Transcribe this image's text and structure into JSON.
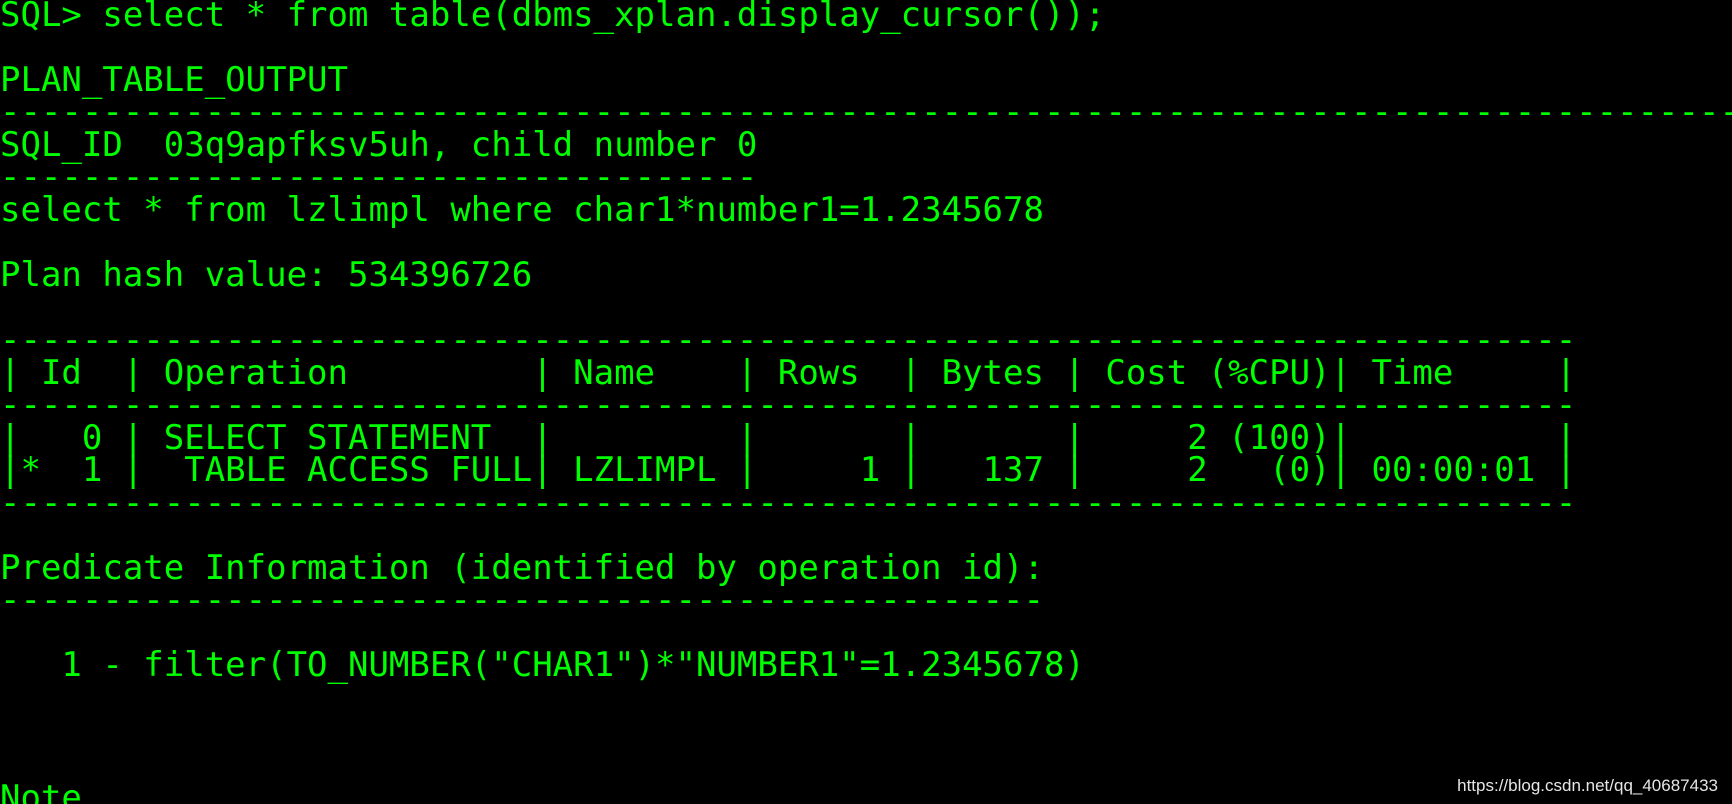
{
  "terminal": {
    "theme": {
      "background": "#000000",
      "foreground": "#00ff00"
    },
    "lines": [
      "SQL> select * from table(dbms_xplan.display_cursor());",
      "PLAN_TABLE_OUTPUT",
      "------------------------------------------------------------------------------------------",
      "SQL_ID  03q9apfksv5uh, child number 0",
      "-------------------------------------",
      "select * from lzlimpl where char1*number1=1.2345678",
      "Plan hash value: 534396726",
      "-----------------------------------------------------------------------------",
      "| Id  | Operation         | Name    | Rows  | Bytes | Cost (%CPU)| Time     |",
      "-----------------------------------------------------------------------------",
      "|   0 | SELECT STATEMENT  |         |       |       |     2 (100)|          |",
      "|*  1 |  TABLE ACCESS FULL| LZLIMPL |     1 |   137 |     2   (0)| 00:00:01 |",
      "-----------------------------------------------------------------------------",
      "Predicate Information (identified by operation id):",
      "---------------------------------------------------",
      "   1 - filter(TO_NUMBER(\"CHAR1\")*\"NUMBER1\"=1.2345678)",
      "Note"
    ]
  },
  "watermark": "https://blog.csdn.net/qq_40687433"
}
